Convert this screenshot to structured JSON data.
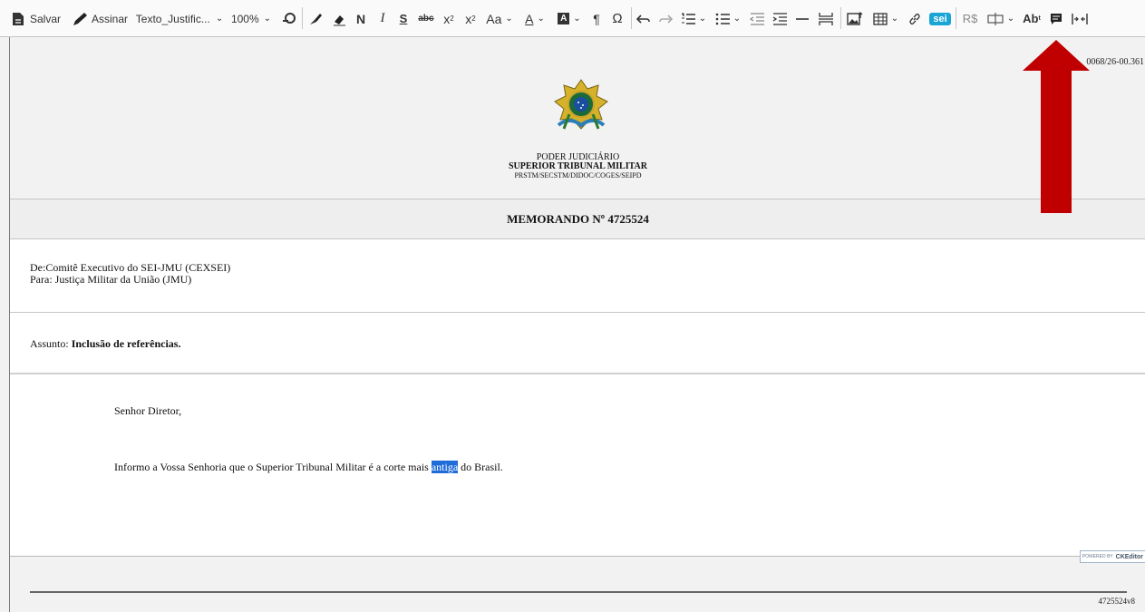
{
  "toolbar": {
    "save_label": "Salvar",
    "sign_label": "Assinar",
    "style_label": "Texto_Justific...",
    "zoom_label": "100%",
    "bold": "N",
    "italic": "I",
    "underline": "S",
    "strike": "abc",
    "subscript": "x",
    "subscript_mark": "2",
    "superscript": "x",
    "superscript_mark": "2",
    "font_size": "Aa",
    "font_color": "A",
    "bg_color": "A",
    "pilcrow": "¶",
    "omega": "Ω",
    "sei_badge": "sei",
    "currency": "R$",
    "abbreviation": "Ab",
    "abbreviation_mark": "t",
    "icons": [
      "document-save-icon",
      "pen-icon",
      "dropdown-icon",
      "find-replace-icon",
      "format-painter-icon",
      "eraser-icon",
      "undo-icon",
      "redo-icon",
      "numbered-list-icon",
      "bulleted-list-icon",
      "outdent-icon",
      "indent-icon",
      "horizontal-line-icon",
      "page-break-icon",
      "image-upload-icon",
      "table-icon",
      "link-icon",
      "sei-link-icon",
      "currency-icon",
      "field-icon",
      "abbreviation-icon",
      "comment-icon",
      "spacing-icon"
    ]
  },
  "document": {
    "code_top": "0068/26-00.361",
    "org_line1": "PODER JUDICIÁRIO",
    "org_line2": "SUPERIOR TRIBUNAL MILITAR",
    "org_line3": "PRSTM/SECSTM/DIDOC/COGES/SEIPD",
    "memo_title": "MEMORANDO Nº 4725524",
    "from": "De:Comitê Executivo do SEI-JMU (CEXSEI)",
    "to": "Para: Justiça Militar da União (JMU)",
    "subject_prefix": "Assunto: ",
    "subject_bold": "Inclusão de referências.",
    "greeting": "Senhor Diretor,",
    "body_before": "Informo a Vossa Senhoria que o Superior Tribunal Militar é a corte mais ",
    "body_selected": "antiga",
    "body_after": " do Brasil.",
    "footer_code": "4725524v8",
    "powered_by": "POWERED BY",
    "ckeditor": "CKEditor"
  },
  "colors": {
    "arrow": "#c00000",
    "selection": "#1f6bd8",
    "sei_badge": "#1aa5d6"
  }
}
